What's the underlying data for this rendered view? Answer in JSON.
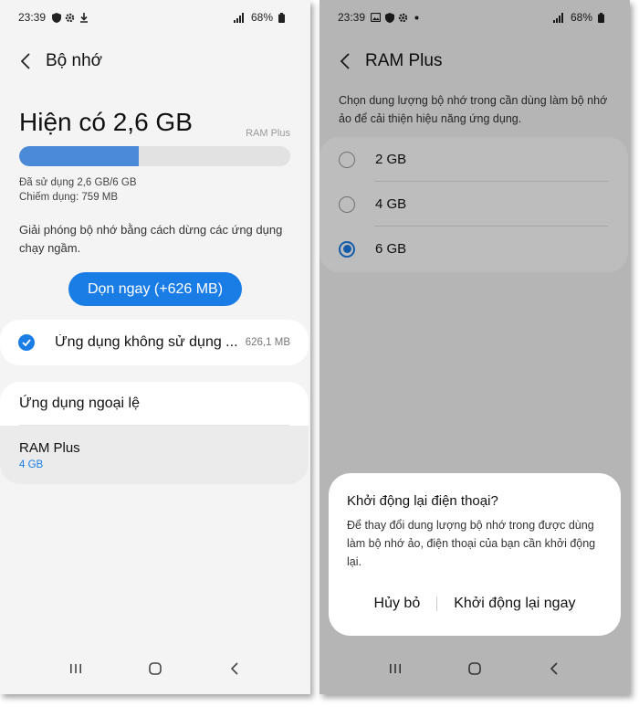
{
  "left": {
    "status": {
      "time": "23:39",
      "battery": "68%"
    },
    "header": {
      "title": "Bộ nhớ"
    },
    "available": "Hiện có 2,6 GB",
    "ram_plus_tag": "RAM Plus",
    "usage_fraction": 0.44,
    "used": "Đã sử dụng 2,6 GB/6 GB",
    "occupied": "Chiếm dụng: 759 MB",
    "description": "Giải phóng bộ nhớ bằng cách dừng các ứng dụng chạy ngầm.",
    "clean_button": "Dọn ngay (+626 MB)",
    "unused_apps": {
      "label": "Ứng dụng không sử dụng ...",
      "size": "626,1 MB"
    },
    "exceptions": "Ứng dụng ngoại lệ",
    "ram_plus": {
      "title": "RAM Plus",
      "value": "4 GB"
    }
  },
  "right": {
    "status": {
      "time": "23:39",
      "battery": "68%"
    },
    "header": {
      "title": "RAM Plus"
    },
    "description": "Chọn dung lượng bộ nhớ trong cần dùng làm bộ nhớ ảo để cải thiện hiệu năng ứng dụng.",
    "options": [
      {
        "label": "2 GB",
        "selected": false
      },
      {
        "label": "4 GB",
        "selected": false
      },
      {
        "label": "6 GB",
        "selected": true
      }
    ],
    "dialog": {
      "title": "Khởi động lại điện thoại?",
      "body": "Để thay đổi dung lượng bộ nhớ trong được dùng làm bộ nhớ ảo, điện thoại của bạn cần khởi động lại.",
      "cancel": "Hủy bỏ",
      "confirm": "Khởi động lại ngay"
    }
  },
  "colors": {
    "accent": "#1a7de6",
    "bar_fill": "#4a8ad6"
  }
}
